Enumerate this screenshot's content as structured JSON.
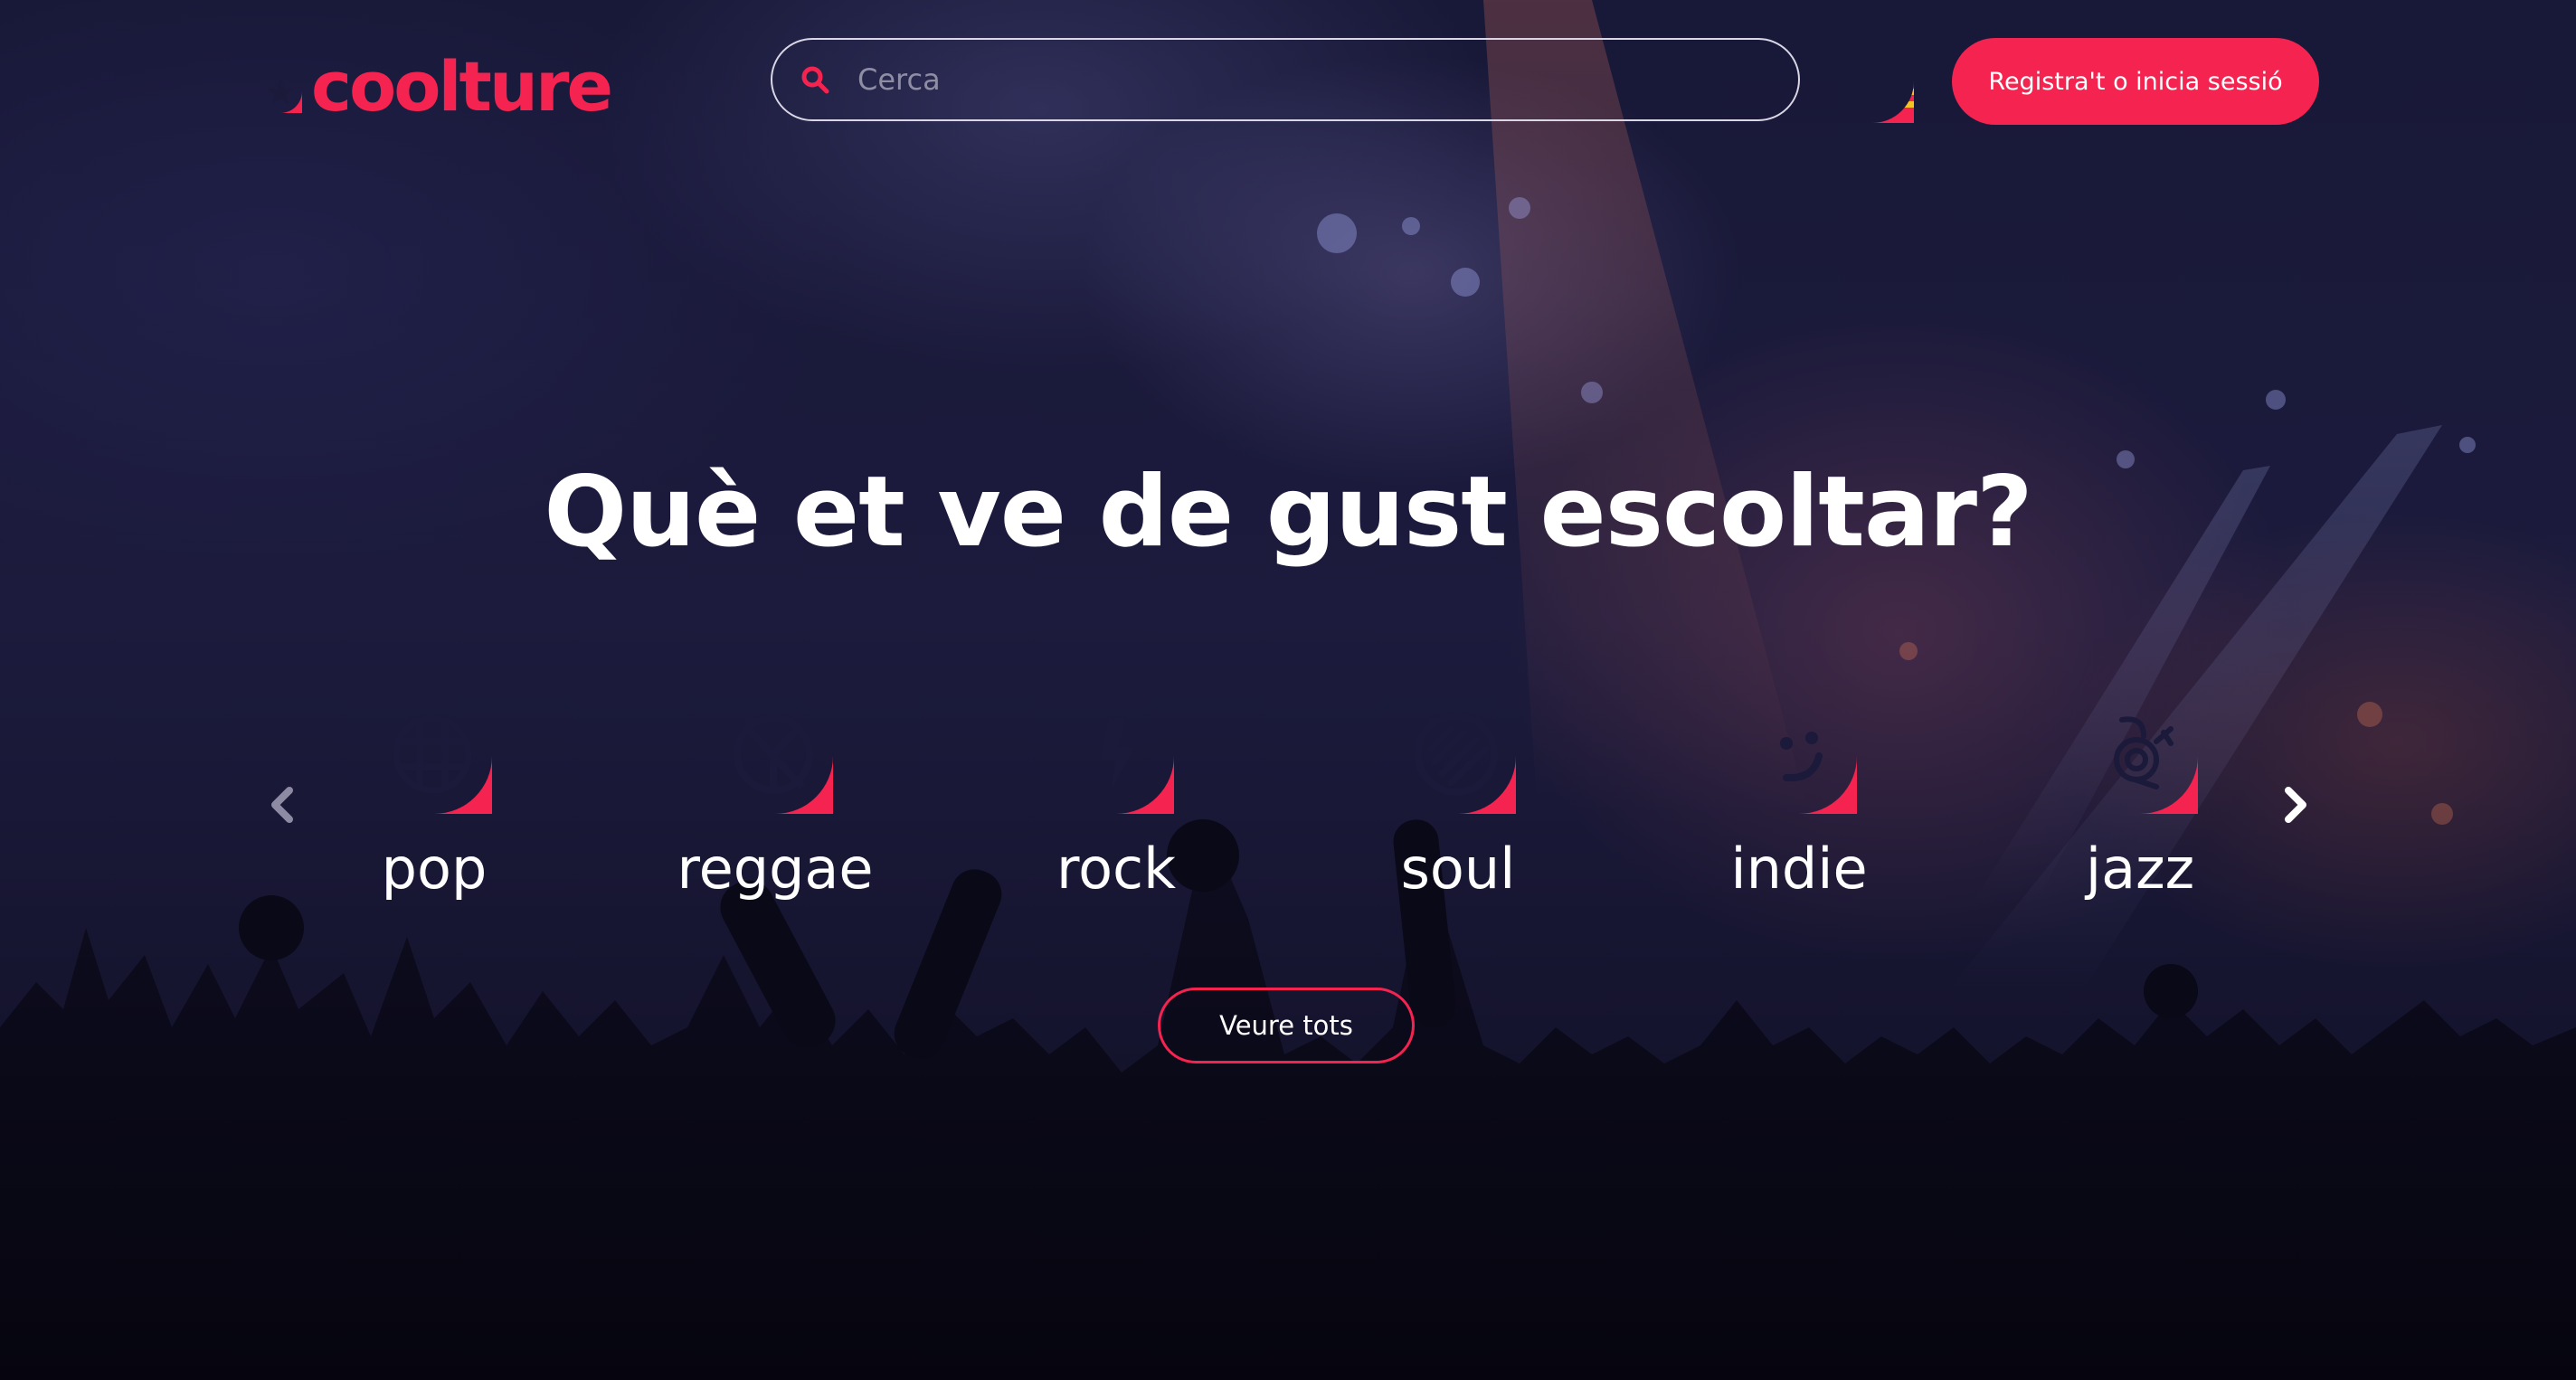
{
  "colors": {
    "accent": "#f5234f",
    "text": "#ffffff",
    "background": "#181838"
  },
  "header": {
    "logo_text": "coolture",
    "search": {
      "placeholder": "Cerca",
      "value": ""
    },
    "language_flag": "catalan-flag-icon",
    "auth_button_label": "Registra't o inicia sessió"
  },
  "hero": {
    "headline": "Què et ve de gust escoltar?",
    "genres": [
      {
        "label": "pop",
        "icon": "globe-grid-icon"
      },
      {
        "label": "reggae",
        "icon": "peace-icon"
      },
      {
        "label": "rock",
        "icon": "lightning-icon"
      },
      {
        "label": "soul",
        "icon": "vinyl-stripes-icon"
      },
      {
        "label": "indie",
        "icon": "smile-icon"
      },
      {
        "label": "jazz",
        "icon": "saxophone-icon"
      }
    ],
    "prev_icon": "chevron-left-icon",
    "next_icon": "chevron-right-icon",
    "see_all_label": "Veure tots"
  }
}
